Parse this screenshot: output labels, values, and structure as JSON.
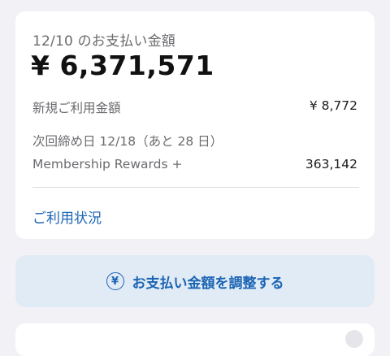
{
  "summary": {
    "due_label": "12/10 のお支払い金額",
    "amount": "¥ 6,371,571",
    "new_usage_label": "新規ご利用金額",
    "new_usage_value": "¥ 8,772",
    "closing_label": "次回締め日 12/18（あと 28 日）",
    "rewards_label": "Membership Rewards +",
    "rewards_value": "363,142",
    "usage_link": "ご利用状況"
  },
  "adjust_button": {
    "icon": "yen-circle-icon",
    "icon_glyph": "¥",
    "label": "お支払い金額を調整する"
  },
  "colors": {
    "accent": "#1b64b4",
    "button_bg": "#e1ebf5",
    "background": "#f2f2f6"
  }
}
